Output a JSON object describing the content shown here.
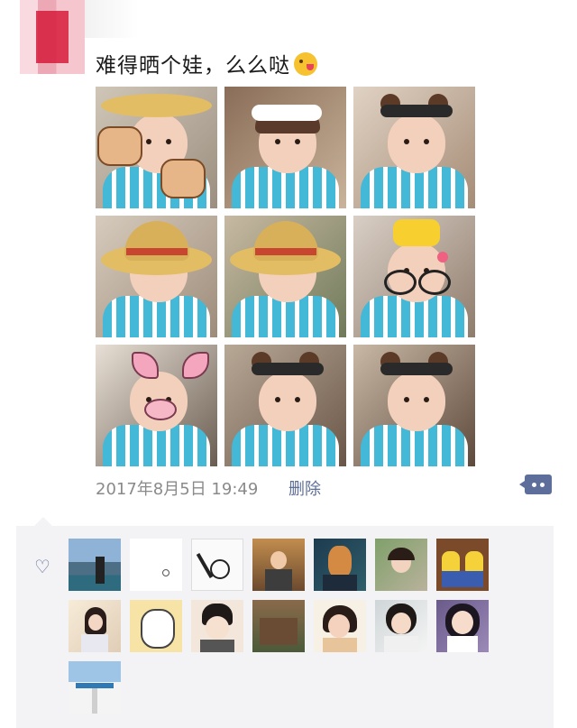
{
  "post": {
    "text": "难得晒个娃，么么哒",
    "timestamp": "2017年8月5日  19:49",
    "delete_label": "删除",
    "photo_count": 9
  },
  "icons": {
    "emoji": "tongue-wink-emoji-icon",
    "comment": "comment-dots-icon",
    "like": "heart-outline-icon"
  },
  "colors": {
    "link": "#5d6e9a",
    "timestamp": "#8a8a8a",
    "likes_bg": "#f3f3f5"
  },
  "likes": {
    "count": 15
  }
}
